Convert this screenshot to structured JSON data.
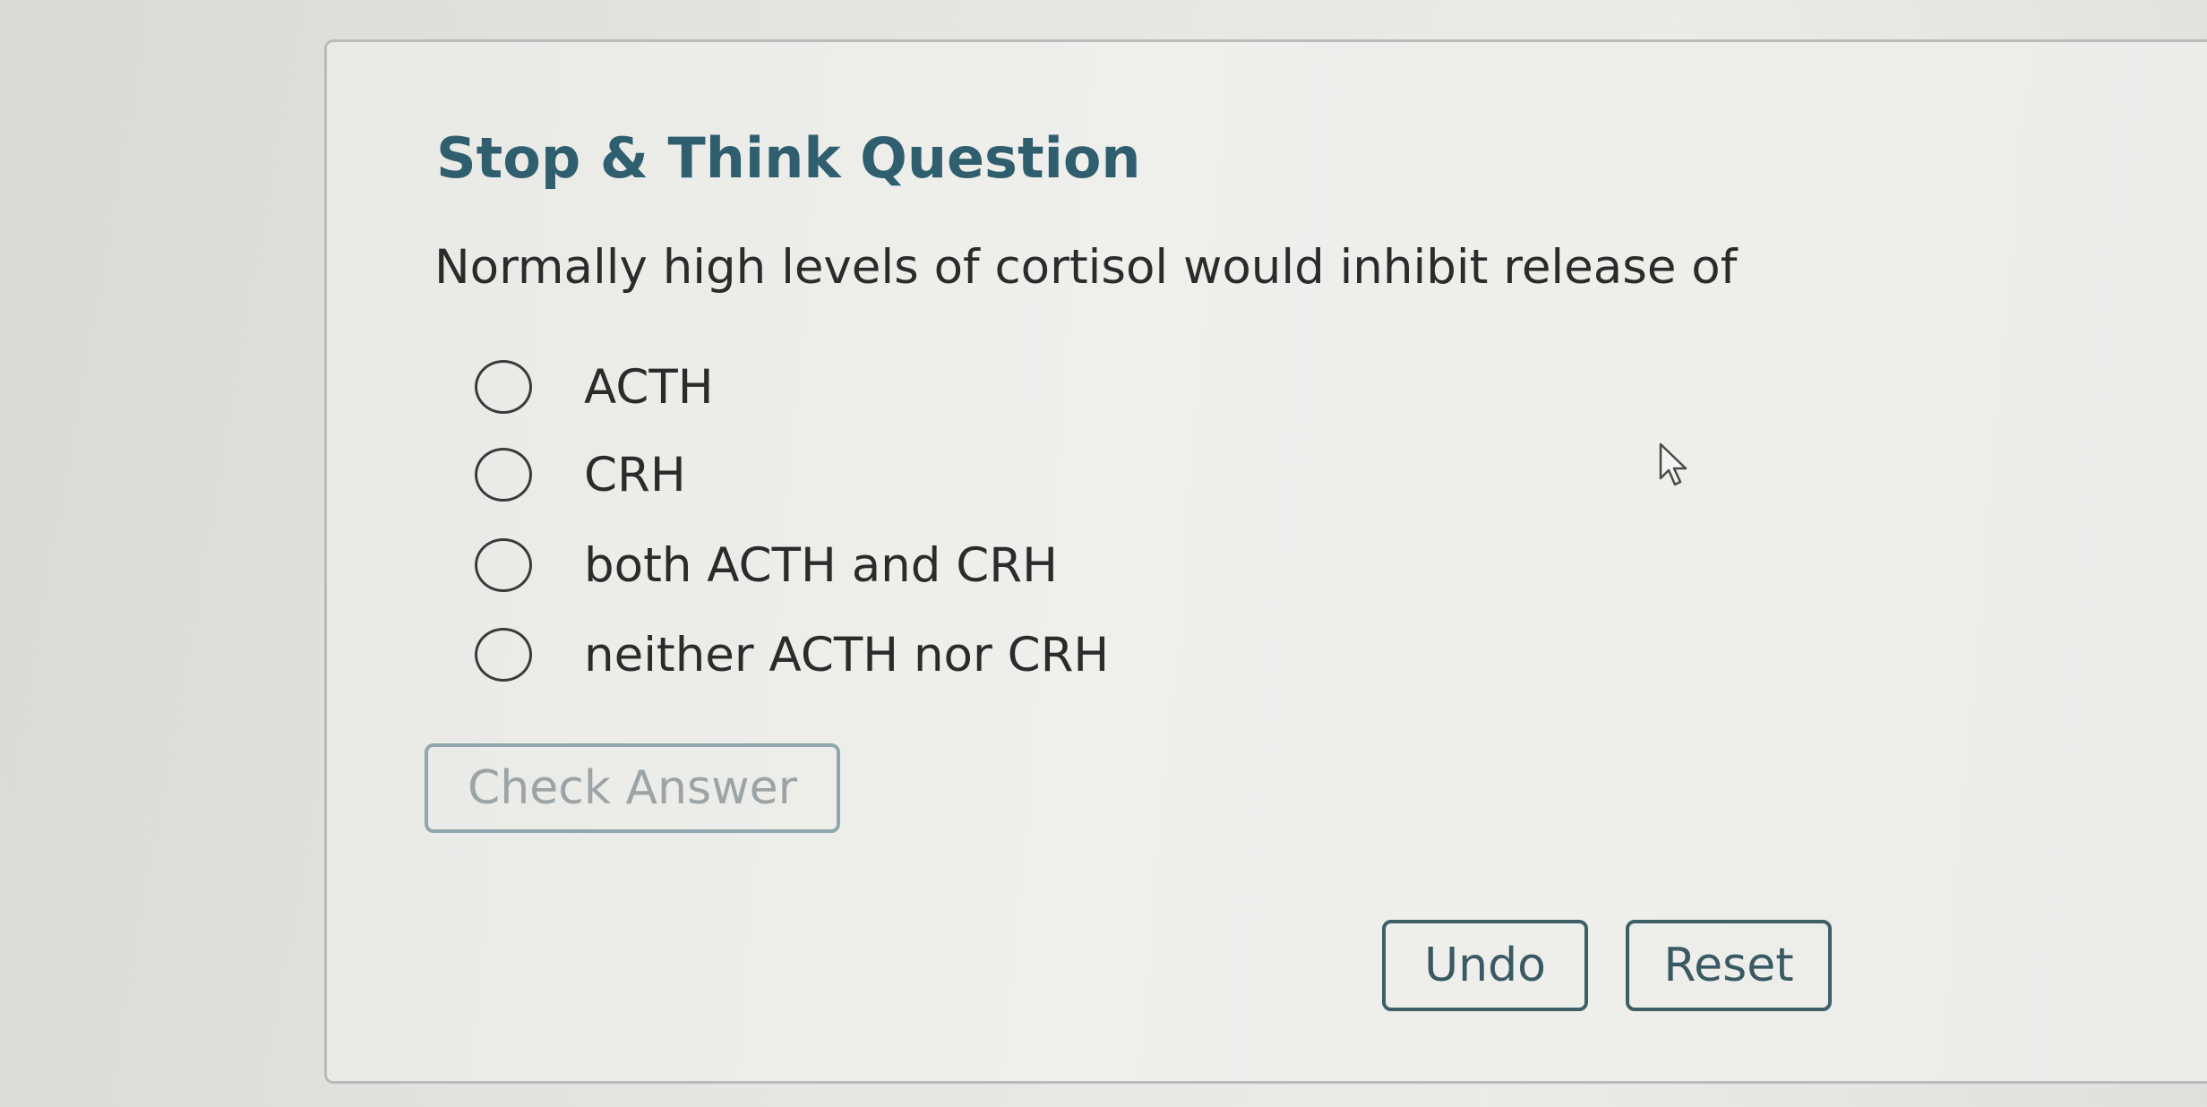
{
  "card": {
    "title": "Stop & Think Question",
    "question": "Normally high levels of cortisol would inhibit release of"
  },
  "options": [
    {
      "label": "ACTH",
      "selected": false
    },
    {
      "label": "CRH",
      "selected": false
    },
    {
      "label": "both ACTH and CRH",
      "selected": false
    },
    {
      "label": "neither ACTH nor CRH",
      "selected": false
    }
  ],
  "buttons": {
    "check_answer": "Check Answer",
    "check_answer_enabled": false,
    "undo": "Undo",
    "reset": "Reset"
  },
  "icons": {
    "radio": "radio-unchecked-icon",
    "cursor": "mouse-pointer-icon"
  },
  "colors": {
    "title": "#2f5f6e",
    "button_border": "#3d5f68",
    "disabled_text": "#9ca4a6"
  }
}
